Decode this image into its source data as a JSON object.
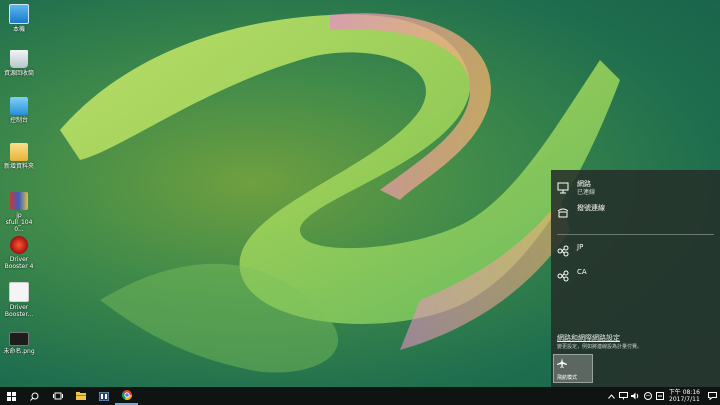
{
  "desktop": {
    "icons": [
      {
        "label": "本機"
      },
      {
        "label": "資源回收筒"
      },
      {
        "label": "控制台"
      },
      {
        "label": "新增資料夾"
      },
      {
        "label": "jp\nsfull_1040..."
      },
      {
        "label": "Driver\nBooster 4"
      },
      {
        "label": "Driver\nBooster..."
      },
      {
        "label": "未命名.png"
      }
    ]
  },
  "network_flyout": {
    "items": [
      {
        "name": "網路",
        "status": "已連線",
        "icon": "ethernet-icon"
      },
      {
        "name": "撥號連線",
        "status": "",
        "icon": "dialup-icon"
      },
      {
        "name": "JP",
        "status": "",
        "icon": "vpn-icon"
      },
      {
        "name": "CA",
        "status": "",
        "icon": "vpn-icon"
      }
    ],
    "settings_link": "網路和網際網路設定",
    "settings_hint": "變更設定，例如將連線設為計量付費。",
    "airplane_label": "飛航模式"
  },
  "taskbar": {
    "buttons": [
      "start-icon",
      "search-icon",
      "task-view-icon",
      "file-explorer-icon",
      "app-icon",
      "chrome-icon"
    ],
    "tray_icons": [
      "chevron-up-icon",
      "network-icon",
      "volume-icon",
      "wechat-icon",
      "input-method-icon"
    ],
    "time": "下午 08:16",
    "date": "2017/7/11"
  }
}
